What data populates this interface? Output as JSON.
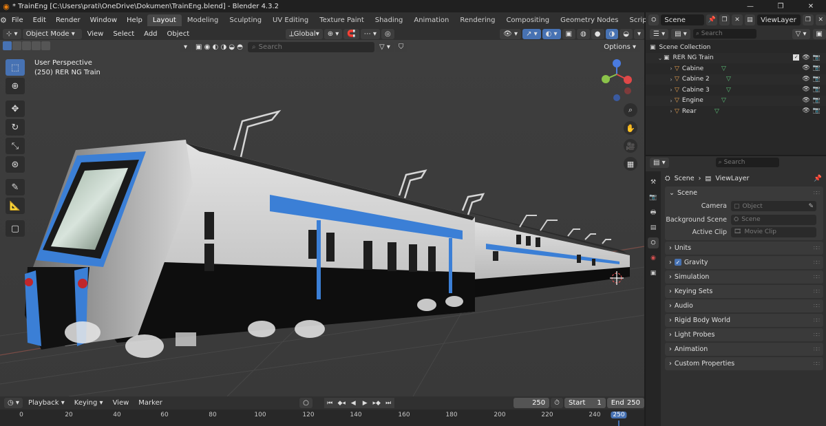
{
  "window": {
    "title": "* TrainEng [C:\\Users\\prati\\OneDrive\\Dokumen\\TrainEng.blend] - Blender 4.3.2",
    "minimize": "—",
    "maximize": "❐",
    "close": "✕"
  },
  "menus": [
    "File",
    "Edit",
    "Render",
    "Window",
    "Help"
  ],
  "workspaces": [
    {
      "label": "Layout",
      "active": true
    },
    {
      "label": "Modeling"
    },
    {
      "label": "Sculpting"
    },
    {
      "label": "UV Editing"
    },
    {
      "label": "Texture Paint"
    },
    {
      "label": "Shading"
    },
    {
      "label": "Animation"
    },
    {
      "label": "Rendering"
    },
    {
      "label": "Compositing"
    },
    {
      "label": "Geometry Nodes"
    },
    {
      "label": "Scripting"
    }
  ],
  "scene_selector": {
    "scene": "Scene",
    "view_layer": "ViewLayer"
  },
  "viewport_header": {
    "mode": "Object Mode",
    "menus": [
      "View",
      "Select",
      "Add",
      "Object"
    ],
    "transform_orientation": "Global",
    "search_placeholder": "Search",
    "options": "Options"
  },
  "viewport": {
    "perspective": "User Perspective",
    "active_object": "(250) RER NG Train"
  },
  "timeline": {
    "menus": [
      "Playback",
      "Keying",
      "View",
      "Marker"
    ],
    "current_frame": "250",
    "start_label": "Start",
    "start": "1",
    "end_label": "End",
    "end": "250",
    "ticks": [
      "0",
      "20",
      "40",
      "60",
      "80",
      "100",
      "120",
      "140",
      "160",
      "180",
      "200",
      "220",
      "240"
    ],
    "playhead": "250"
  },
  "outliner": {
    "search_placeholder": "Search",
    "root": "Scene Collection",
    "collection": "RER NG Train",
    "objects": [
      "Cabine",
      "Cabine 2",
      "Cabine 3",
      "Engine",
      "Rear"
    ]
  },
  "properties": {
    "search_placeholder": "Search",
    "breadcrumb_scene": "Scene",
    "breadcrumb_layer": "ViewLayer",
    "panel_scene": "Scene",
    "fields": [
      {
        "label": "Camera",
        "placeholder": "Object"
      },
      {
        "label": "Background Scene",
        "placeholder": "Scene"
      },
      {
        "label": "Active Clip",
        "placeholder": "Movie Clip"
      }
    ],
    "panels": [
      "Units",
      "Gravity",
      "Simulation",
      "Keying Sets",
      "Audio",
      "Rigid Body World",
      "Light Probes",
      "Animation",
      "Custom Properties"
    ]
  },
  "colors": {
    "accent": "#4772b3",
    "train_blue": "#3b7fd6",
    "object_orange": "#e8a050",
    "mesh_green": "#5cc47a"
  }
}
